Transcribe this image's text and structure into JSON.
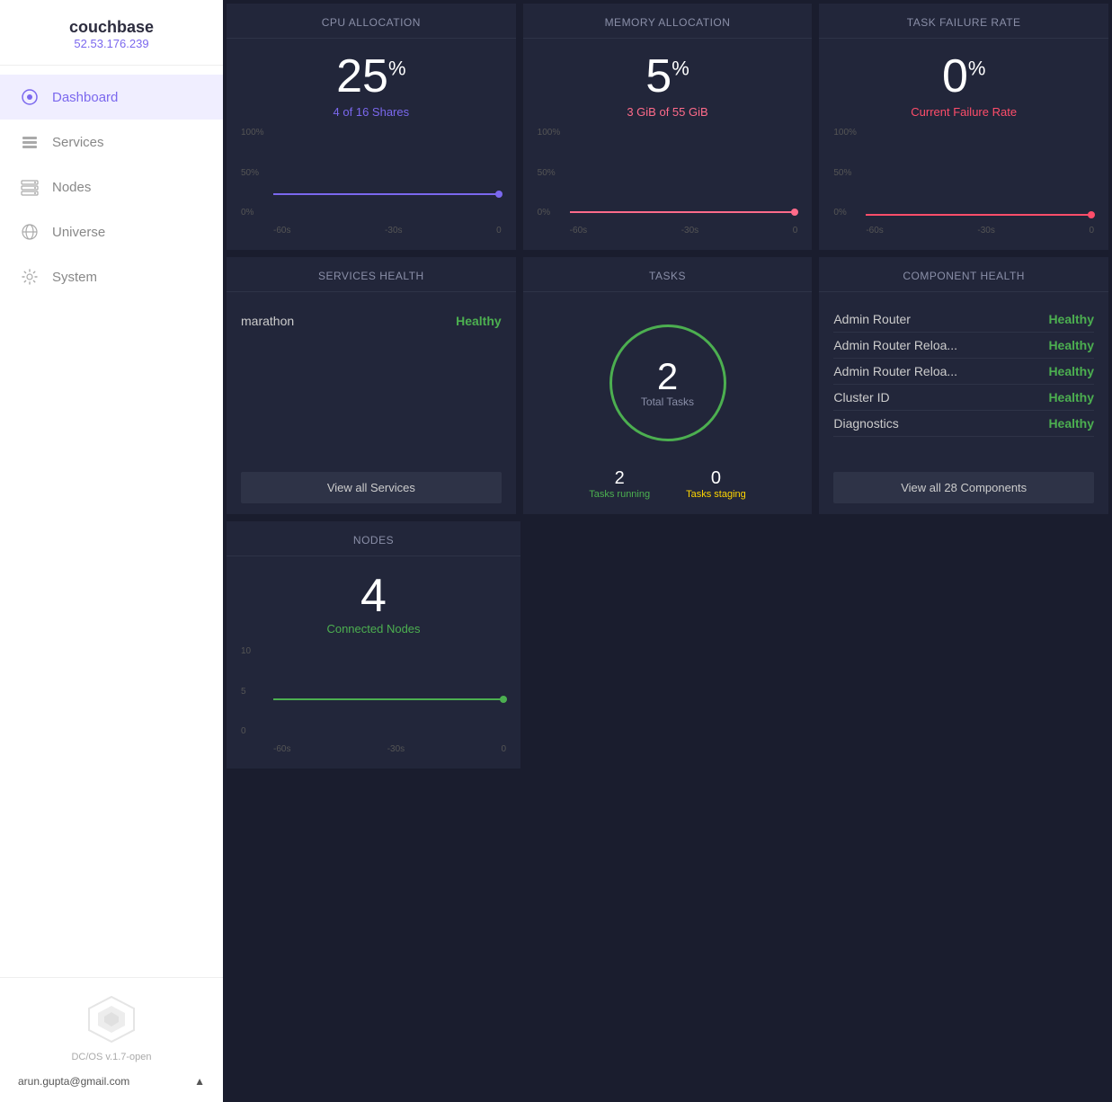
{
  "sidebar": {
    "cluster_name": "couchbase",
    "cluster_ip": "52.53.176.239",
    "nav_items": [
      {
        "id": "dashboard",
        "label": "Dashboard",
        "active": true
      },
      {
        "id": "services",
        "label": "Services",
        "active": false
      },
      {
        "id": "nodes",
        "label": "Nodes",
        "active": false
      },
      {
        "id": "universe",
        "label": "Universe",
        "active": false
      },
      {
        "id": "system",
        "label": "System",
        "active": false
      }
    ],
    "dcos_version": "DC/OS v.1.7-open",
    "user_email": "arun.gupta@gmail.com"
  },
  "cpu": {
    "title": "CPU Allocation",
    "value": "25",
    "unit": "%",
    "sub": "4 of 16 Shares",
    "sub_color": "purple",
    "chart_y": [
      "100%",
      "50%",
      "0%"
    ],
    "chart_x": [
      "-60s",
      "-30s",
      "0"
    ],
    "bar_height_pct": 25,
    "line_color": "#7b68ee",
    "dot_color": "#7b68ee"
  },
  "memory": {
    "title": "Memory Allocation",
    "value": "5",
    "unit": "%",
    "sub": "3 GiB of 55 GiB",
    "sub_color": "pink",
    "chart_y": [
      "100%",
      "50%",
      "0%"
    ],
    "chart_x": [
      "-60s",
      "-30s",
      "0"
    ],
    "bar_height_pct": 5,
    "line_color": "#ff6b8a",
    "dot_color": "#ff6b8a"
  },
  "task_failure": {
    "title": "Task Failure Rate",
    "value": "0",
    "unit": "%",
    "sub": "Current Failure Rate",
    "sub_color": "red",
    "chart_y": [
      "100%",
      "50%",
      "0%"
    ],
    "chart_x": [
      "-60s",
      "-30s",
      "0"
    ],
    "bar_height_pct": 0,
    "line_color": "#ff4d6a",
    "dot_color": "#ff4d6a"
  },
  "services_health": {
    "title": "Services Health",
    "items": [
      {
        "name": "marathon",
        "status": "Healthy",
        "color": "green"
      }
    ],
    "button_label": "View all Services"
  },
  "tasks": {
    "title": "Tasks",
    "total": "2",
    "total_label": "Total Tasks",
    "running": "2",
    "running_label": "Tasks running",
    "staging": "0",
    "staging_label": "Tasks staging"
  },
  "component_health": {
    "title": "Component Health",
    "items": [
      {
        "name": "Admin Router",
        "status": "Healthy"
      },
      {
        "name": "Admin Router Reloa...",
        "status": "Healthy"
      },
      {
        "name": "Admin Router Reloa...",
        "status": "Healthy"
      },
      {
        "name": "Cluster ID",
        "status": "Healthy"
      },
      {
        "name": "Diagnostics",
        "status": "Healthy"
      }
    ],
    "button_label": "View all 28 Components"
  },
  "nodes": {
    "title": "Nodes",
    "value": "4",
    "sub": "Connected Nodes",
    "chart_y": [
      "10",
      "5",
      "0"
    ],
    "chart_x": [
      "-60s",
      "-30s",
      "0"
    ],
    "bar_height_pct": 40,
    "line_color": "#4caf50",
    "dot_color": "#4caf50"
  }
}
